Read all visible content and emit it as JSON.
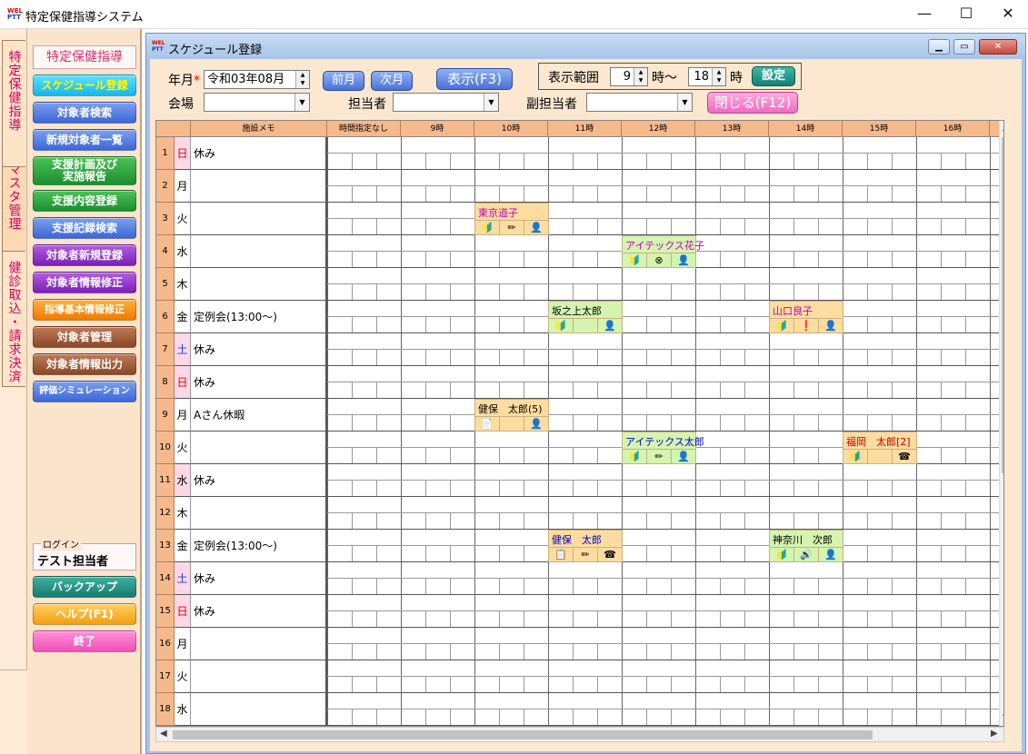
{
  "app": {
    "title": "特定保健指導システム",
    "logo_top": "WEL",
    "logo_bottom": "PTT",
    "minimize": "—",
    "maximize": "☐",
    "close": "✕"
  },
  "vtabs": [
    "特定保健指導",
    "マスタ管理",
    "健診取込・請求決済"
  ],
  "menu": {
    "heading": "特定保健指導",
    "buttons": [
      {
        "label": "スケジュール登録",
        "color": "cyan"
      },
      {
        "label": "対象者検索",
        "color": "blue"
      },
      {
        "label": "新規対象者一覧",
        "color": "blue"
      },
      {
        "label": "支援計画及び 実施報告",
        "color": "green"
      },
      {
        "label": "支援内容登録",
        "color": "green"
      },
      {
        "label": "支援記録検索",
        "color": "blue"
      },
      {
        "label": "対象者新規登録",
        "color": "purple"
      },
      {
        "label": "対象者情報修正",
        "color": "purple"
      },
      {
        "label": "指導基本情報修正",
        "color": "orange"
      },
      {
        "label": "対象者管理",
        "color": "brown"
      },
      {
        "label": "対象者情報出力",
        "color": "brown"
      },
      {
        "label": "評価シミュレーション",
        "color": "blue"
      }
    ],
    "login_label": "ログイン",
    "login_user": "テスト担当者",
    "bottom_buttons": [
      {
        "label": "バックアップ",
        "color": "teal"
      },
      {
        "label": "ヘルプ(F1)",
        "color": "yellow"
      },
      {
        "label": "終了",
        "color": "pink"
      }
    ]
  },
  "child": {
    "title": "スケジュール登録",
    "close_btn": "✕"
  },
  "form": {
    "month_label": "年月",
    "required_mark": "*",
    "month_value": "令和03年08月",
    "prev_btn": "前月",
    "next_btn": "次月",
    "show_btn": "表示(F3)",
    "range_label": "表示範囲",
    "range_start": "9",
    "range_mid": "時～",
    "range_end": "18",
    "range_suffix": "時",
    "set_btn": "設定",
    "venue_label": "会場",
    "venue_value": "",
    "staff_label": "担当者",
    "staff_value": "",
    "sub_staff_label": "副担当者",
    "sub_staff_value": "",
    "close_btn": "閉じる(F12)"
  },
  "grid": {
    "headers": {
      "memo": "施設メモ",
      "notime": "時間指定なし",
      "hours": [
        "9時",
        "10時",
        "11時",
        "12時",
        "13時",
        "14時",
        "15時",
        "16時",
        "17時"
      ]
    },
    "rows": [
      {
        "day": "1",
        "dow": "日",
        "memo": "休み",
        "type": "sun"
      },
      {
        "day": "2",
        "dow": "月",
        "memo": "",
        "type": ""
      },
      {
        "day": "3",
        "dow": "火",
        "memo": "",
        "type": ""
      },
      {
        "day": "4",
        "dow": "水",
        "memo": "",
        "type": ""
      },
      {
        "day": "5",
        "dow": "木",
        "memo": "",
        "type": ""
      },
      {
        "day": "6",
        "dow": "金",
        "memo": "定例会(13:00～)",
        "type": ""
      },
      {
        "day": "7",
        "dow": "土",
        "memo": "休み",
        "type": "sat"
      },
      {
        "day": "8",
        "dow": "日",
        "memo": "休み",
        "type": "sun"
      },
      {
        "day": "9",
        "dow": "月",
        "memo": "Aさん休暇",
        "type": ""
      },
      {
        "day": "10",
        "dow": "火",
        "memo": "",
        "type": ""
      },
      {
        "day": "11",
        "dow": "水",
        "memo": "休み",
        "type": "hol"
      },
      {
        "day": "12",
        "dow": "木",
        "memo": "",
        "type": ""
      },
      {
        "day": "13",
        "dow": "金",
        "memo": "定例会(13:00～)",
        "type": ""
      },
      {
        "day": "14",
        "dow": "土",
        "memo": "休み",
        "type": "sat"
      },
      {
        "day": "15",
        "dow": "日",
        "memo": "休み",
        "type": "sun"
      },
      {
        "day": "16",
        "dow": "月",
        "memo": "",
        "type": ""
      },
      {
        "day": "17",
        "dow": "火",
        "memo": "",
        "type": ""
      },
      {
        "day": "18",
        "dow": "水",
        "memo": "",
        "type": ""
      }
    ],
    "appointments": [
      {
        "row": 3,
        "slot": 6,
        "name": "東京道子",
        "name_color": "#c000c0",
        "bg": "orange",
        "icons": [
          "🔰",
          "✏",
          "👤"
        ]
      },
      {
        "row": 4,
        "slot": 12,
        "name": "アイテックス花子",
        "name_color": "#c000c0",
        "bg": "green",
        "icons": [
          "🔰",
          "⊗",
          "👤"
        ]
      },
      {
        "row": 6,
        "slot": 9,
        "name": "坂之上太郎",
        "name_color": "#000000",
        "bg": "green",
        "icons": [
          "🔰",
          "",
          "👤"
        ]
      },
      {
        "row": 6,
        "slot": 18,
        "name": "山口良子",
        "name_color": "#c000c0",
        "bg": "orange",
        "icons": [
          "🔰",
          "❗",
          "👤"
        ]
      },
      {
        "row": 9,
        "slot": 6,
        "name": "健保　太郎(5)",
        "name_color": "#000000",
        "bg": "orange",
        "icons": [
          "📄",
          "",
          "👤"
        ]
      },
      {
        "row": 10,
        "slot": 12,
        "name": "アイテックス太郎",
        "name_color": "#0000c0",
        "bg": "green",
        "icons": [
          "🔰",
          "✏",
          "👤"
        ]
      },
      {
        "row": 10,
        "slot": 21,
        "name": "福岡　太郎[2]",
        "name_color": "#c00000",
        "bg": "orange",
        "icons": [
          "🔰",
          "",
          "☎"
        ]
      },
      {
        "row": 13,
        "slot": 9,
        "name": "健保　太郎",
        "name_color": "#0000c0",
        "bg": "orange",
        "icons": [
          "📋",
          "✏",
          "☎"
        ]
      },
      {
        "row": 13,
        "slot": 18,
        "name": "神奈川　次郎",
        "name_color": "#000000",
        "bg": "green",
        "icons": [
          "🔰",
          "🔊",
          "👤"
        ]
      }
    ]
  },
  "colors": {
    "header_bg": "#f5b98c",
    "form_bg": "#fce8d0",
    "menu_bg": "#fbe4cc"
  }
}
